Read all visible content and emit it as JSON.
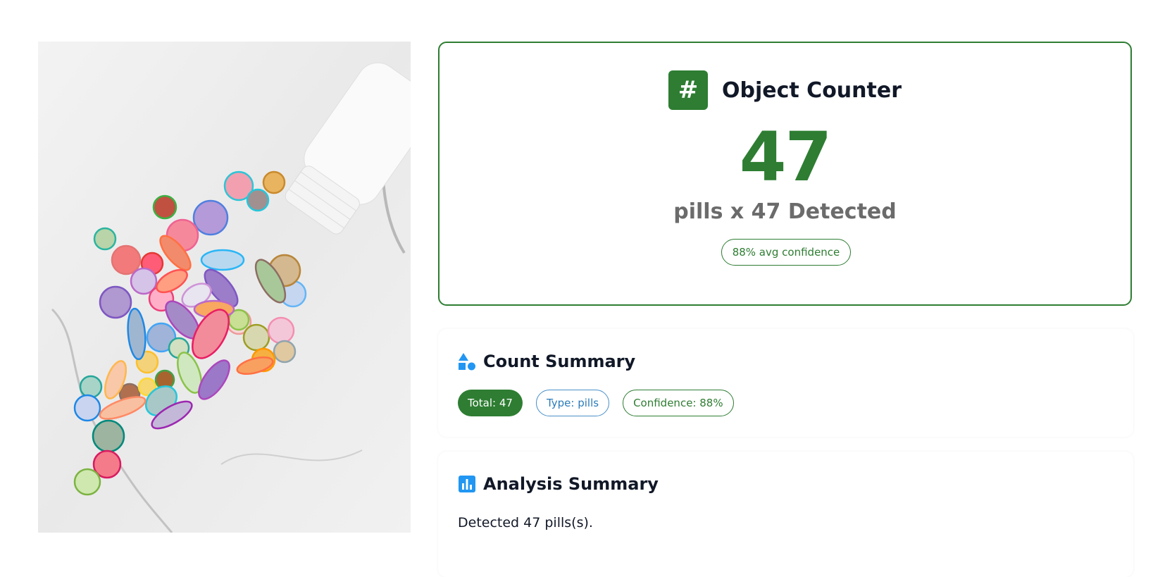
{
  "image": {
    "alt": "pills"
  },
  "counter": {
    "icon": "hash-icon",
    "title": "Object Counter",
    "count": "47",
    "detected_label": "pills x 47 Detected",
    "confidence_badge": "88% avg confidence"
  },
  "count_summary": {
    "icon": "shapes-icon",
    "title": "Count Summary",
    "chips": {
      "total": "Total: 47",
      "type": "Type: pills",
      "confidence": "Confidence: 88%"
    }
  },
  "analysis_summary": {
    "icon": "bar-chart-icon",
    "title": "Analysis Summary",
    "text": "Detected 47 pills(s)."
  },
  "colors": {
    "accent_green": "#2e7d32",
    "accent_blue": "#2196f3",
    "muted_text": "#6b6b6b"
  }
}
